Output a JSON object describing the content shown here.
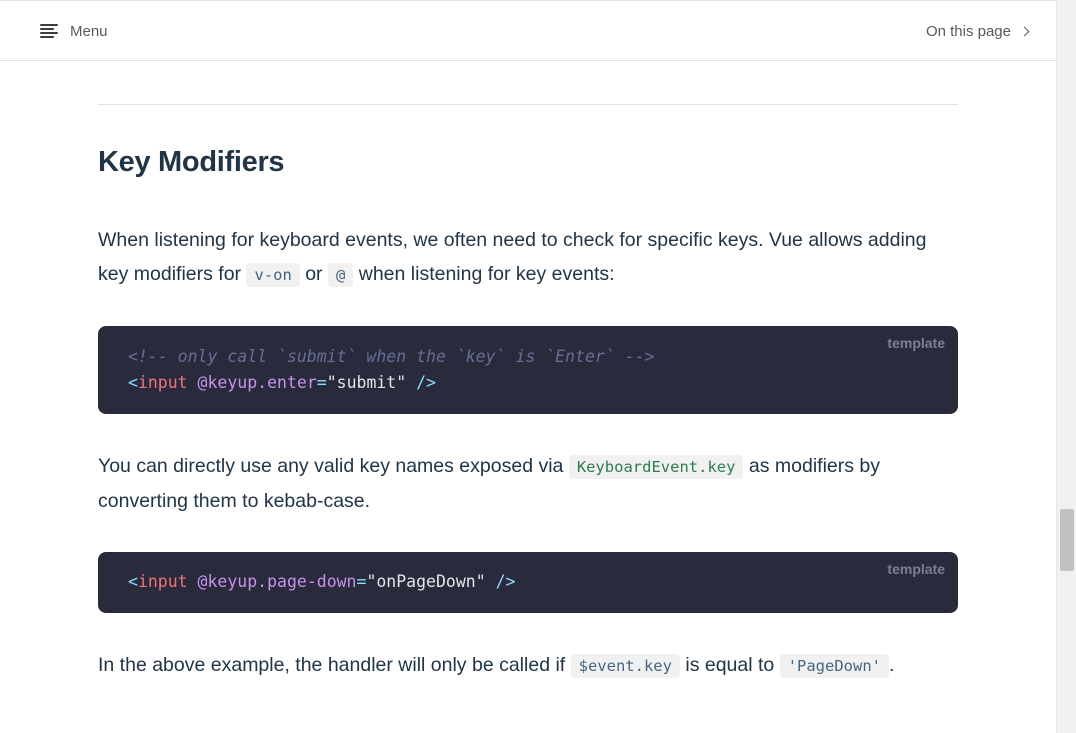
{
  "topbar": {
    "menu_label": "Menu",
    "menu_icon": "menu-lines-icon",
    "on_this_page_label": "On this page",
    "chevron_icon": "chevron-right-icon"
  },
  "section": {
    "title": "Key Modifiers",
    "p1": {
      "text_a": "When listening for keyboard events, we often need to check for specific keys. Vue allows adding key modifiers for ",
      "code_a": "v-on",
      "text_b": " or ",
      "code_b": "@",
      "text_c": " when listening for key events:"
    },
    "code1": {
      "lang": "template",
      "comment": "<!-- only call `submit` when the `key` is `Enter` -->",
      "open": "<",
      "tag": "input",
      "attr_event": "@keyup",
      "attr_mod": ".enter",
      "eq": "=",
      "value": "\"submit\"",
      "close": " />"
    },
    "p2": {
      "text_a": "You can directly use any valid key names exposed via ",
      "code_a": "KeyboardEvent.key",
      "text_b": " as modifiers by converting them to kebab-case."
    },
    "code2": {
      "lang": "template",
      "open": "<",
      "tag": "input",
      "attr_event": "@keyup",
      "attr_mod": ".page-down",
      "eq": "=",
      "value": "\"onPageDown\"",
      "close": " />"
    },
    "p3": {
      "text_a": "In the above example, the handler will only be called if ",
      "code_a": "$event.key",
      "text_b": " is equal to ",
      "code_b": "'PageDown'",
      "text_c": "."
    }
  },
  "colors": {
    "code_bg": "#292b3c",
    "text": "#213547",
    "inline_code_bg": "#f1f1f1"
  }
}
